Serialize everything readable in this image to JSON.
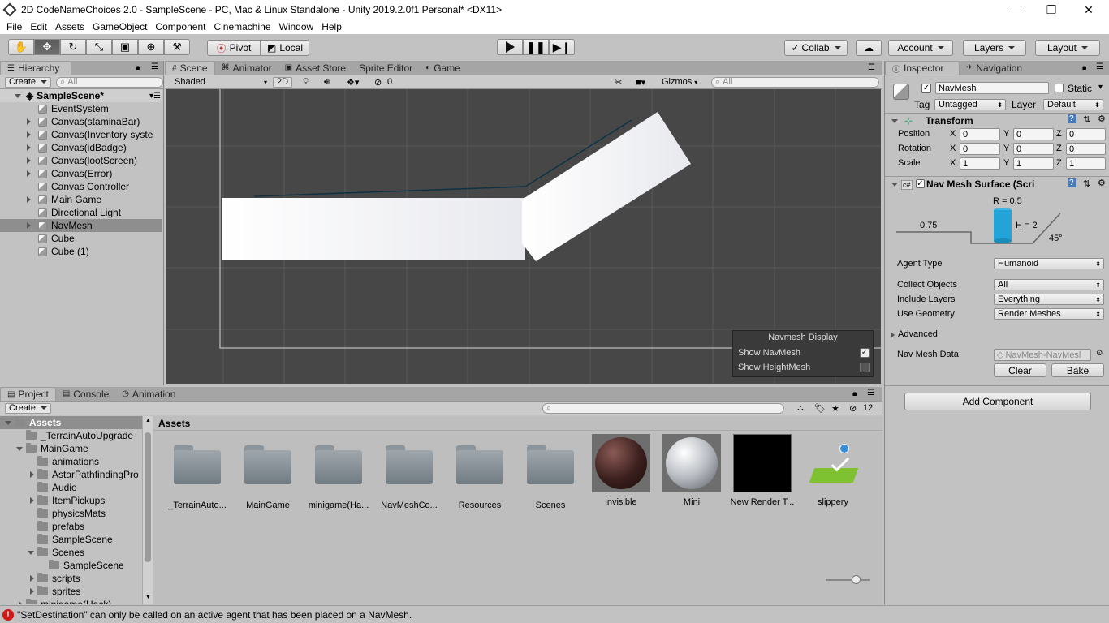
{
  "window": {
    "title": "2D CodeNameChoices 2.0 - SampleScene - PC, Mac & Linux Standalone - Unity 2019.2.0f1 Personal* <DX11>",
    "controls": [
      "—",
      "❐",
      "✕"
    ]
  },
  "menu": [
    "File",
    "Edit",
    "Assets",
    "GameObject",
    "Component",
    "Cinemachine",
    "Window",
    "Help"
  ],
  "toolbar": {
    "pivot_label": "Pivot",
    "local_label": "Local",
    "collab_label": "Collab",
    "account_label": "Account",
    "layers_label": "Layers",
    "layout_label": "Layout"
  },
  "hierarchy": {
    "tab": "Hierarchy",
    "create_label": "Create",
    "search_placeholder": "All",
    "scene_name": "SampleScene*",
    "items": [
      {
        "label": "EventSystem",
        "expandable": false,
        "selected": false
      },
      {
        "label": "Canvas(staminaBar)",
        "expandable": true,
        "selected": false
      },
      {
        "label": "Canvas(Inventory syste",
        "expandable": true,
        "selected": false
      },
      {
        "label": "Canvas(idBadge)",
        "expandable": true,
        "selected": false
      },
      {
        "label": "Canvas(lootScreen)",
        "expandable": true,
        "selected": false
      },
      {
        "label": "Canvas(Error)",
        "expandable": true,
        "selected": false
      },
      {
        "label": "Canvas Controller",
        "expandable": false,
        "selected": false
      },
      {
        "label": "Main Game",
        "expandable": true,
        "selected": false
      },
      {
        "label": "Directional Light",
        "expandable": false,
        "selected": false
      },
      {
        "label": "NavMesh",
        "expandable": true,
        "selected": true
      },
      {
        "label": "Cube",
        "expandable": false,
        "selected": false
      },
      {
        "label": "Cube (1)",
        "expandable": false,
        "selected": false
      }
    ]
  },
  "scene_tabs": [
    {
      "label": "Scene",
      "icon": "#",
      "active": true
    },
    {
      "label": "Animator",
      "icon": "⌘",
      "active": false
    },
    {
      "label": "Asset Store",
      "icon": "▣",
      "active": false
    },
    {
      "label": "Sprite Editor",
      "icon": "",
      "active": false
    },
    {
      "label": "Game",
      "icon": "◐",
      "active": false
    }
  ],
  "scene_bar": {
    "shading": "Shaded",
    "mode_2d": "2D",
    "hidden_count": "0",
    "gizmos_label": "Gizmos",
    "search_placeholder": "All"
  },
  "navmesh_display": {
    "title": "Navmesh Display",
    "show_navmesh_label": "Show NavMesh",
    "show_navmesh": true,
    "show_heightmesh_label": "Show HeightMesh",
    "show_heightmesh": false
  },
  "inspector": {
    "tabs": [
      "Inspector",
      "Navigation"
    ],
    "object_name": "NavMesh",
    "static_label": "Static",
    "tag_label": "Tag",
    "tag_value": "Untagged",
    "layer_label": "Layer",
    "layer_value": "Default",
    "transform": {
      "title": "Transform",
      "rows": [
        {
          "label": "Position",
          "x": "0",
          "y": "0",
          "z": "0"
        },
        {
          "label": "Rotation",
          "x": "0",
          "y": "0",
          "z": "0"
        },
        {
          "label": "Scale",
          "x": "1",
          "y": "1",
          "z": "1"
        }
      ],
      "axis": {
        "x": "X",
        "y": "Y",
        "z": "Z"
      }
    },
    "navmesh_surface": {
      "title": "Nav Mesh Surface (Scri",
      "radius_label": "R = 0.5",
      "height_label": "H = 2",
      "step_label": "0.75",
      "slope_label": "45°",
      "agent_type_label": "Agent Type",
      "agent_type_value": "Humanoid",
      "collect_objects_label": "Collect Objects",
      "collect_objects_value": "All",
      "include_layers_label": "Include Layers",
      "include_layers_value": "Everything",
      "use_geometry_label": "Use Geometry",
      "use_geometry_value": "Render Meshes",
      "advanced_label": "Advanced",
      "navmesh_data_label": "Nav Mesh Data",
      "navmesh_data_value": "NavMesh-NavMesl",
      "clear_label": "Clear",
      "bake_label": "Bake"
    },
    "add_component_label": "Add Component"
  },
  "project": {
    "tabs": [
      {
        "label": "Project",
        "icon": "▤",
        "active": true
      },
      {
        "label": "Console",
        "icon": "▤",
        "active": false
      },
      {
        "label": "Animation",
        "icon": "◷",
        "active": false
      }
    ],
    "create_label": "Create",
    "count": "12",
    "tree": [
      {
        "label": "Assets",
        "depth": 0,
        "expanded": true,
        "selected": true,
        "arrow": true
      },
      {
        "label": "_TerrainAutoUpgrade",
        "depth": 1,
        "expanded": false,
        "selected": false,
        "arrow": false
      },
      {
        "label": "MainGame",
        "depth": 1,
        "expanded": true,
        "selected": false,
        "arrow": true
      },
      {
        "label": "animations",
        "depth": 2,
        "expanded": false,
        "selected": false,
        "arrow": false
      },
      {
        "label": "AstarPathfindingPro",
        "depth": 2,
        "expanded": false,
        "selected": false,
        "arrow": true
      },
      {
        "label": "Audio",
        "depth": 2,
        "expanded": false,
        "selected": false,
        "arrow": false
      },
      {
        "label": "ItemPickups",
        "depth": 2,
        "expanded": false,
        "selected": false,
        "arrow": true
      },
      {
        "label": "physicsMats",
        "depth": 2,
        "expanded": false,
        "selected": false,
        "arrow": false
      },
      {
        "label": "prefabs",
        "depth": 2,
        "expanded": false,
        "selected": false,
        "arrow": false
      },
      {
        "label": "SampleScene",
        "depth": 2,
        "expanded": false,
        "selected": false,
        "arrow": false
      },
      {
        "label": "Scenes",
        "depth": 2,
        "expanded": true,
        "selected": false,
        "arrow": true
      },
      {
        "label": "SampleScene",
        "depth": 3,
        "expanded": false,
        "selected": false,
        "arrow": false
      },
      {
        "label": "scripts",
        "depth": 2,
        "expanded": false,
        "selected": false,
        "arrow": true
      },
      {
        "label": "sprites",
        "depth": 2,
        "expanded": false,
        "selected": false,
        "arrow": true
      },
      {
        "label": "minigame(Hack)",
        "depth": 1,
        "expanded": false,
        "selected": false,
        "arrow": true
      }
    ],
    "breadcrumb": "Assets",
    "assets": [
      {
        "label": "_TerrainAuto...",
        "kind": "folder"
      },
      {
        "label": "MainGame",
        "kind": "folder"
      },
      {
        "label": "minigame(Ha...",
        "kind": "folder"
      },
      {
        "label": "NavMeshCo...",
        "kind": "folder"
      },
      {
        "label": "Resources",
        "kind": "folder"
      },
      {
        "label": "Scenes",
        "kind": "folder"
      },
      {
        "label": "invisible",
        "kind": "material-dark"
      },
      {
        "label": "Mini",
        "kind": "material-light"
      },
      {
        "label": "New Render T...",
        "kind": "render-texture"
      },
      {
        "label": "slippery",
        "kind": "physics-material"
      }
    ]
  },
  "status": {
    "message": "\"SetDestination\" can only be called on an active agent that has been placed on a NavMesh.",
    "error_color": "#d31616"
  }
}
